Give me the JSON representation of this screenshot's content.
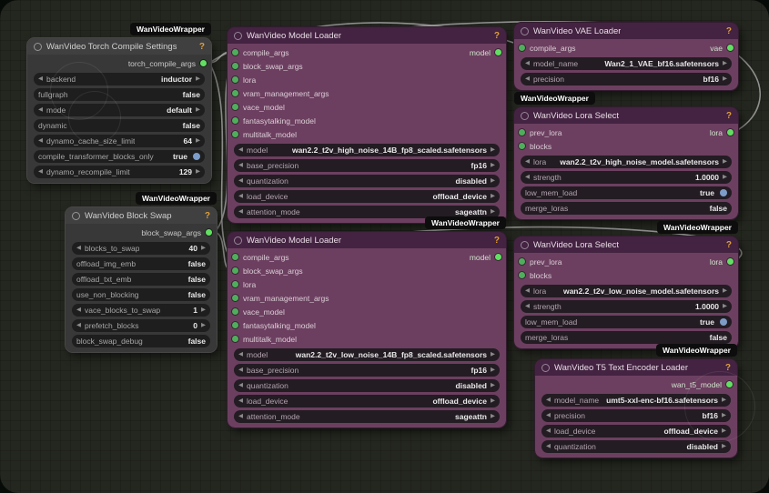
{
  "badge": "WanVideoWrapper",
  "help": "?",
  "colors": {
    "canvas_bg": "#24271f",
    "node_gray": "#383838",
    "node_purple_body": "#6c3f60",
    "node_purple_header": "#432341",
    "slot_green": "#5ecf5e",
    "toggle_blue": "#7d9cc8",
    "help_orange": "#de9e3a",
    "badge_bg": "#0d0d0d",
    "link_gray": "#adadad"
  },
  "nodes": {
    "torch": {
      "title": "WanVideo Torch Compile Settings",
      "output": "torch_compile_args",
      "widgets": [
        {
          "label": "backend",
          "value": "inductor"
        },
        {
          "label": "fullgraph",
          "value": "false"
        },
        {
          "label": "mode",
          "value": "default"
        },
        {
          "label": "dynamic",
          "value": "false"
        },
        {
          "label": "dynamo_cache_size_limit",
          "value": "64"
        },
        {
          "label": "compile_transformer_blocks_only",
          "value": "true"
        },
        {
          "label": "dynamo_recompile_limit",
          "value": "129"
        }
      ]
    },
    "blockswap": {
      "title": "WanVideo Block Swap",
      "output": "block_swap_args",
      "widgets": [
        {
          "label": "blocks_to_swap",
          "value": "40"
        },
        {
          "label": "offload_img_emb",
          "value": "false"
        },
        {
          "label": "offload_txt_emb",
          "value": "false"
        },
        {
          "label": "use_non_blocking",
          "value": "false"
        },
        {
          "label": "vace_blocks_to_swap",
          "value": "1"
        },
        {
          "label": "prefetch_blocks",
          "value": "0"
        },
        {
          "label": "block_swap_debug",
          "value": "false"
        }
      ]
    },
    "loader_high": {
      "title": "WanVideo Model Loader",
      "output": "model",
      "inputs": [
        "compile_args",
        "block_swap_args",
        "lora",
        "vram_management_args",
        "vace_model",
        "fantasytalking_model",
        "multitalk_model"
      ],
      "widgets": [
        {
          "label": "model",
          "value": "wan2.2_t2v_high_noise_14B_fp8_scaled.safetensors"
        },
        {
          "label": "base_precision",
          "value": "fp16"
        },
        {
          "label": "quantization",
          "value": "disabled"
        },
        {
          "label": "load_device",
          "value": "offload_device"
        },
        {
          "label": "attention_mode",
          "value": "sageattn"
        }
      ]
    },
    "loader_low": {
      "title": "WanVideo Model Loader",
      "output": "model",
      "inputs": [
        "compile_args",
        "block_swap_args",
        "lora",
        "vram_management_args",
        "vace_model",
        "fantasytalking_model",
        "multitalk_model"
      ],
      "widgets": [
        {
          "label": "model",
          "value": "wan2.2_t2v_low_noise_14B_fp8_scaled.safetensors"
        },
        {
          "label": "base_precision",
          "value": "fp16"
        },
        {
          "label": "quantization",
          "value": "disabled"
        },
        {
          "label": "load_device",
          "value": "offload_device"
        },
        {
          "label": "attention_mode",
          "value": "sageattn"
        }
      ]
    },
    "vae": {
      "title": "WanVideo VAE Loader",
      "output": "vae",
      "inputs": [
        "compile_args"
      ],
      "widgets": [
        {
          "label": "model_name",
          "value": "Wan2_1_VAE_bf16.safetensors"
        },
        {
          "label": "precision",
          "value": "bf16"
        }
      ]
    },
    "lora_high": {
      "title": "WanVideo Lora Select",
      "output": "lora",
      "inputs": [
        "prev_lora",
        "blocks"
      ],
      "widgets": [
        {
          "label": "lora",
          "value": "wan2.2_t2v_high_noise_model.safetensors"
        },
        {
          "label": "strength",
          "value": "1.0000"
        },
        {
          "label": "low_mem_load",
          "value": "true"
        },
        {
          "label": "merge_loras",
          "value": "false"
        }
      ]
    },
    "lora_low": {
      "title": "WanVideo Lora Select",
      "output": "lora",
      "inputs": [
        "prev_lora",
        "blocks"
      ],
      "widgets": [
        {
          "label": "lora",
          "value": "wan2.2_t2v_low_noise_model.safetensors"
        },
        {
          "label": "strength",
          "value": "1.0000"
        },
        {
          "label": "low_mem_load",
          "value": "true"
        },
        {
          "label": "merge_loras",
          "value": "false"
        }
      ]
    },
    "t5": {
      "title": "WanVideo T5 Text Encoder Loader",
      "output": "wan_t5_model",
      "widgets": [
        {
          "label": "model_name",
          "value": "umt5-xxl-enc-bf16.safetensors"
        },
        {
          "label": "precision",
          "value": "bf16"
        },
        {
          "label": "load_device",
          "value": "offload_device"
        },
        {
          "label": "quantization",
          "value": "disabled"
        }
      ]
    }
  }
}
